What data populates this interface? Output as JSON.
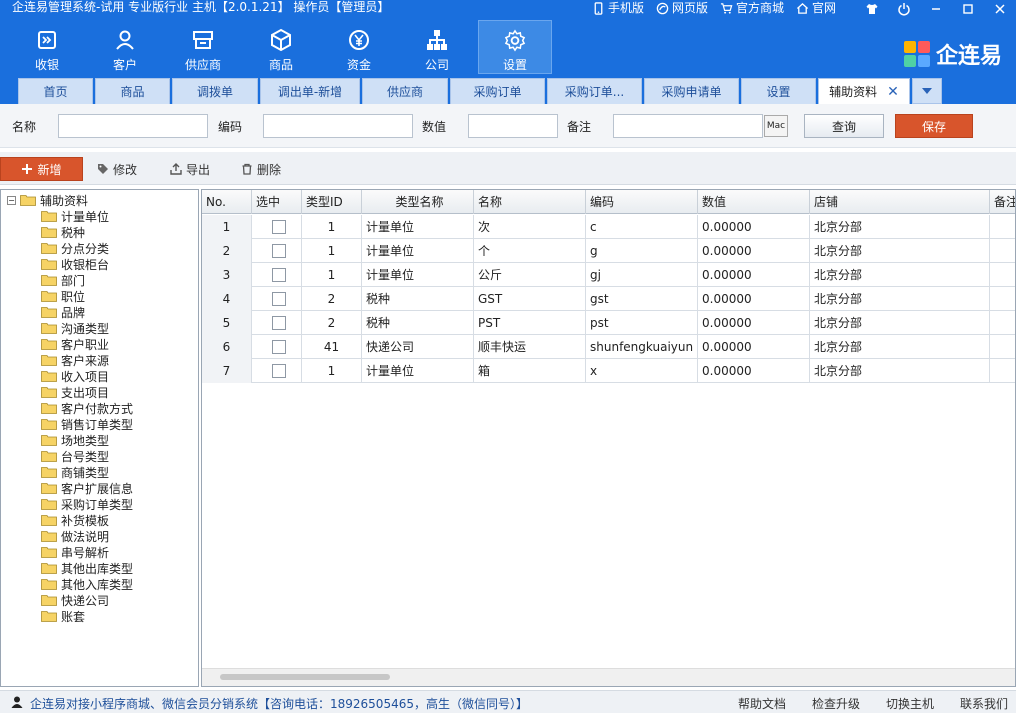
{
  "app": {
    "title": "企连易管理系统-试用 专业版行业 主机【2.0.1.21】 操作员【管理员】",
    "brand": "企连易"
  },
  "top_links": [
    {
      "label": "手机版",
      "icon": "mobile-icon"
    },
    {
      "label": "网页版",
      "icon": "browser-icon"
    },
    {
      "label": "官方商城",
      "icon": "cart-icon"
    },
    {
      "label": "官网",
      "icon": "home-icon"
    }
  ],
  "main_nav": [
    {
      "label": "收银",
      "icon": "cashier-icon"
    },
    {
      "label": "客户",
      "icon": "user-icon"
    },
    {
      "label": "供应商",
      "icon": "supplier-icon"
    },
    {
      "label": "商品",
      "icon": "box-icon"
    },
    {
      "label": "资金",
      "icon": "yen-icon"
    },
    {
      "label": "公司",
      "icon": "org-icon"
    },
    {
      "label": "设置",
      "icon": "gear-icon",
      "active": true
    }
  ],
  "tabs": [
    {
      "label": "首页"
    },
    {
      "label": "商品"
    },
    {
      "label": "调拨单"
    },
    {
      "label": "调出单-新增"
    },
    {
      "label": "供应商"
    },
    {
      "label": "采购订单"
    },
    {
      "label": "采购订单..."
    },
    {
      "label": "采购申请单"
    },
    {
      "label": "设置"
    },
    {
      "label": "辅助资料",
      "active": true
    }
  ],
  "filter": {
    "name_label": "名称",
    "code_label": "编码",
    "value_label": "数值",
    "note_label": "备注",
    "mac_label": "Mac",
    "query_label": "查询",
    "save_label": "保存"
  },
  "toolbar": {
    "add_label": "新增",
    "edit_label": "修改",
    "export_label": "导出",
    "delete_label": "删除"
  },
  "tree": {
    "root": "辅助资料",
    "items": [
      "计量单位",
      "税种",
      "分点分类",
      "收银柜台",
      "部门",
      "职位",
      "品牌",
      "沟通类型",
      "客户职业",
      "客户来源",
      "收入项目",
      "支出项目",
      "客户付款方式",
      "销售订单类型",
      "场地类型",
      "台号类型",
      "商铺类型",
      "客户扩展信息",
      "采购订单类型",
      "补货模板",
      "做法说明",
      "串号解析",
      "其他出库类型",
      "其他入库类型",
      "快递公司",
      "账套"
    ]
  },
  "grid": {
    "columns": [
      "No.",
      "选中",
      "类型ID",
      "类型名称",
      "名称",
      "编码",
      "数值",
      "店铺",
      "备注"
    ],
    "rows": [
      {
        "no": "1",
        "type_id": "1",
        "type_name": "计量单位",
        "name": "次",
        "code": "c",
        "value": "0.00000",
        "shop": "北京分部",
        "note": ""
      },
      {
        "no": "2",
        "type_id": "1",
        "type_name": "计量单位",
        "name": "个",
        "code": "g",
        "value": "0.00000",
        "shop": "北京分部",
        "note": ""
      },
      {
        "no": "3",
        "type_id": "1",
        "type_name": "计量单位",
        "name": "公斤",
        "code": "gj",
        "value": "0.00000",
        "shop": "北京分部",
        "note": ""
      },
      {
        "no": "4",
        "type_id": "2",
        "type_name": "税种",
        "name": "GST",
        "code": "gst",
        "value": "0.00000",
        "shop": "北京分部",
        "note": ""
      },
      {
        "no": "5",
        "type_id": "2",
        "type_name": "税种",
        "name": "PST",
        "code": "pst",
        "value": "0.00000",
        "shop": "北京分部",
        "note": ""
      },
      {
        "no": "6",
        "type_id": "41",
        "type_name": "快递公司",
        "name": "顺丰快运",
        "code": "shunfengkuaiyun",
        "value": "0.00000",
        "shop": "北京分部",
        "note": ""
      },
      {
        "no": "7",
        "type_id": "1",
        "type_name": "计量单位",
        "name": "箱",
        "code": "x",
        "value": "0.00000",
        "shop": "北京分部",
        "note": ""
      }
    ]
  },
  "status": {
    "text": "企连易对接小程序商城、微信会员分销系统【咨询电话：18926505465，高生（微信同号）】",
    "links": [
      "帮助文档",
      "检查升级",
      "切换主机",
      "联系我们"
    ]
  },
  "colors": {
    "header": "#1a6fdd",
    "accent": "#d8552c"
  }
}
